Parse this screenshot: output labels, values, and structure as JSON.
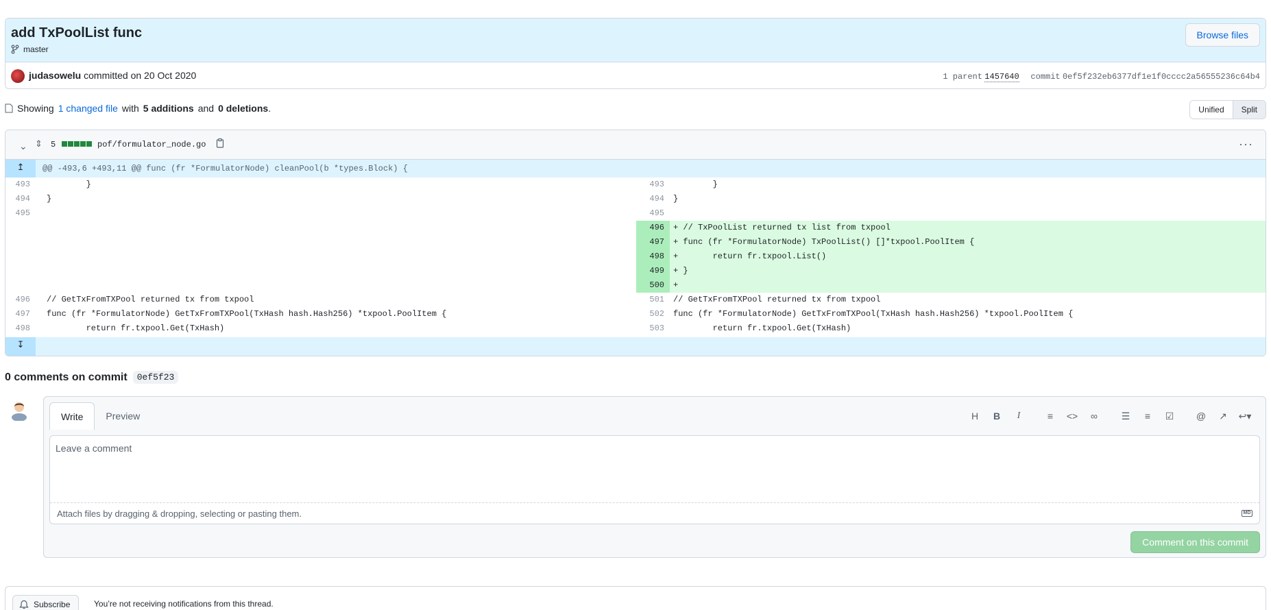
{
  "commit": {
    "title": "add TxPoolList func",
    "branch": "master",
    "browse_label": "Browse files",
    "author": "judasowelu",
    "committed_text": "committed on 20 Oct 2020",
    "parent_prefix": "1 parent",
    "parent_sha": "1457640",
    "commit_prefix": "commit",
    "commit_sha": "0ef5f232eb6377df1e1f0cccc2a56555236c64b4"
  },
  "summary": {
    "showing": "Showing",
    "changed_link": "1 changed file",
    "with": "with",
    "additions": "5 additions",
    "and": "and",
    "deletions": "0 deletions",
    "period": "."
  },
  "view_toggle": {
    "unified": "Unified",
    "split": "Split",
    "active": "split"
  },
  "file": {
    "changes": "5",
    "name": "pof/formulator_node.go",
    "added_blocks": 5,
    "hunk_header": "@@ -493,6 +493,11 @@ func (fr *FormulatorNode) cleanPool(b *types.Block) {"
  },
  "diff": {
    "context_top": [
      {
        "left_ln": "493",
        "right_ln": "493",
        "code": "        }"
      },
      {
        "left_ln": "494",
        "right_ln": "494",
        "code": "}"
      },
      {
        "left_ln": "495",
        "right_ln": "495",
        "code": ""
      }
    ],
    "added": [
      {
        "ln": "496",
        "code": "+ // TxPoolList returned tx list from txpool"
      },
      {
        "ln": "497",
        "code": "+ func (fr *FormulatorNode) TxPoolList() []*txpool.PoolItem {"
      },
      {
        "ln": "498",
        "code": "+       return fr.txpool.List()"
      },
      {
        "ln": "499",
        "code": "+ }"
      },
      {
        "ln": "500",
        "code": "+"
      }
    ],
    "context_bottom": [
      {
        "left_ln": "496",
        "right_ln": "501",
        "code": "// GetTxFromTXPool returned tx from txpool"
      },
      {
        "left_ln": "497",
        "right_ln": "502",
        "code": "func (fr *FormulatorNode) GetTxFromTXPool(TxHash hash.Hash256) *txpool.PoolItem {"
      },
      {
        "left_ln": "498",
        "right_ln": "503",
        "code": "        return fr.txpool.Get(TxHash)"
      }
    ]
  },
  "comments": {
    "title": "0 comments on commit",
    "sha": "0ef5f23",
    "tab_write": "Write",
    "tab_preview": "Preview",
    "placeholder": "Leave a comment",
    "attach_text": "Attach files by dragging & dropping, selecting or pasting them.",
    "submit_label": "Comment on this commit",
    "markdown_badge": "MD",
    "tools": [
      "H",
      "B",
      "I"
    ]
  },
  "subscribe": {
    "button": "Subscribe",
    "text": "You’re not receiving notifications from this thread."
  },
  "colors": {
    "link": "#0969da",
    "added_bg": "#dafbe1",
    "added_gutter": "#aceebb",
    "hunk_bg": "#ddf4ff",
    "submit_disabled": "#94d3a2"
  }
}
